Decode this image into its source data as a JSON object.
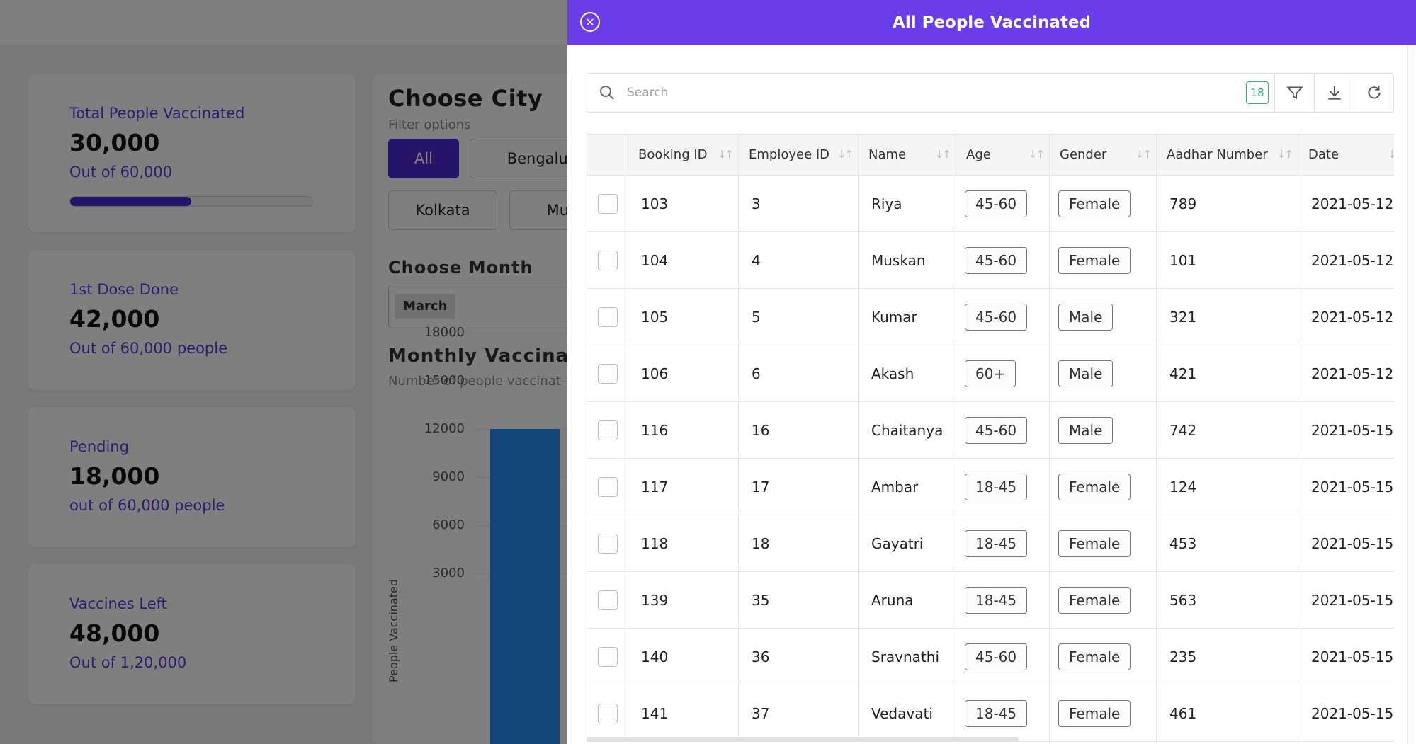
{
  "dashboard": {
    "cards": [
      {
        "label": "Total People Vaccinated",
        "value": "30,000",
        "sub": "Out of 60,000",
        "progress": 0.5
      },
      {
        "label": "1st Dose Done",
        "value": "42,000",
        "sub": "Out of 60,000 people"
      },
      {
        "label": "Pending",
        "value": "18,000",
        "sub": "out of 60,000 people"
      },
      {
        "label": "Vaccines Left",
        "value": "48,000",
        "sub": "Out of 1,20,000"
      }
    ],
    "filter": {
      "title": "Choose City",
      "subtitle": "Filter options",
      "cities": [
        "All",
        "Bengalur",
        "Kolkata",
        "Mun"
      ],
      "month_title": "Choose Month",
      "month_value": "March",
      "chart_title": "Monthly Vaccinatic",
      "chart_subtitle": "Number of people vaccinat"
    }
  },
  "chart_data": {
    "type": "bar",
    "ylabel": "People Vaccinated",
    "ylim": [
      3000,
      18000
    ],
    "yticks": [
      "18000",
      "15000",
      "12000",
      "9000",
      "6000",
      "3000"
    ],
    "values": [
      12000
    ]
  },
  "drawer": {
    "title": "All People Vaccinated",
    "close_icon": "close-circle-icon",
    "search_placeholder": "Search",
    "count": "18",
    "tools": [
      "filter-icon",
      "download-icon",
      "refresh-icon"
    ],
    "columns": [
      "Booking ID",
      "Employee ID",
      "Name",
      "Age",
      "Gender",
      "Aadhar Number",
      "Date"
    ],
    "rows": [
      {
        "booking_id": "103",
        "employee_id": "3",
        "name": "Riya",
        "age": "45-60",
        "gender": "Female",
        "aadhar": "789",
        "date": "2021-05-12"
      },
      {
        "booking_id": "104",
        "employee_id": "4",
        "name": "Muskan",
        "age": "45-60",
        "gender": "Female",
        "aadhar": "101",
        "date": "2021-05-12"
      },
      {
        "booking_id": "105",
        "employee_id": "5",
        "name": "Kumar",
        "age": "45-60",
        "gender": "Male",
        "aadhar": "321",
        "date": "2021-05-12"
      },
      {
        "booking_id": "106",
        "employee_id": "6",
        "name": "Akash",
        "age": "60+",
        "gender": "Male",
        "aadhar": "421",
        "date": "2021-05-12"
      },
      {
        "booking_id": "116",
        "employee_id": "16",
        "name": "Chaitanya",
        "age": "45-60",
        "gender": "Male",
        "aadhar": "742",
        "date": "2021-05-15"
      },
      {
        "booking_id": "117",
        "employee_id": "17",
        "name": "Ambar",
        "age": "18-45",
        "gender": "Female",
        "aadhar": "124",
        "date": "2021-05-15"
      },
      {
        "booking_id": "118",
        "employee_id": "18",
        "name": "Gayatri",
        "age": "18-45",
        "gender": "Female",
        "aadhar": "453",
        "date": "2021-05-15"
      },
      {
        "booking_id": "139",
        "employee_id": "35",
        "name": "Aruna",
        "age": "18-45",
        "gender": "Female",
        "aadhar": "563",
        "date": "2021-05-15"
      },
      {
        "booking_id": "140",
        "employee_id": "36",
        "name": "Sravnathi",
        "age": "45-60",
        "gender": "Female",
        "aadhar": "235",
        "date": "2021-05-15"
      },
      {
        "booking_id": "141",
        "employee_id": "37",
        "name": "Vedavati",
        "age": "18-45",
        "gender": "Female",
        "aadhar": "461",
        "date": "2021-05-15"
      }
    ]
  },
  "colors": {
    "accent": "#6a3de8",
    "primary": "#4a2bd0",
    "bar": "#2a8df0",
    "badge": "#2bb673"
  }
}
